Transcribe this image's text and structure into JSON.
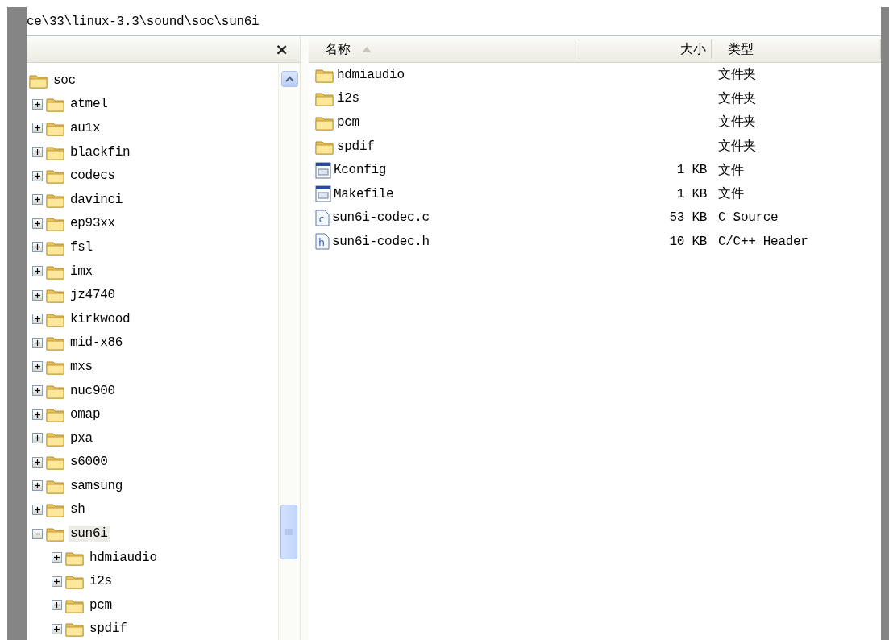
{
  "address": {
    "value": "ce\\33\\linux-3.3\\sound\\soc\\sun6i"
  },
  "folders_pane": {
    "close": "×",
    "tree": [
      {
        "name": "soc",
        "selected": false,
        "children": [
          {
            "name": "atmel",
            "expanded": false,
            "selected": false
          },
          {
            "name": "au1x",
            "expanded": false,
            "selected": false
          },
          {
            "name": "blackfin",
            "expanded": false,
            "selected": false
          },
          {
            "name": "codecs",
            "expanded": false,
            "selected": false
          },
          {
            "name": "davinci",
            "expanded": false,
            "selected": false
          },
          {
            "name": "ep93xx",
            "expanded": false,
            "selected": false
          },
          {
            "name": "fsl",
            "expanded": false,
            "selected": false
          },
          {
            "name": "imx",
            "expanded": false,
            "selected": false
          },
          {
            "name": "jz4740",
            "expanded": false,
            "selected": false
          },
          {
            "name": "kirkwood",
            "expanded": false,
            "selected": false
          },
          {
            "name": "mid-x86",
            "expanded": false,
            "selected": false
          },
          {
            "name": "mxs",
            "expanded": false,
            "selected": false
          },
          {
            "name": "nuc900",
            "expanded": false,
            "selected": false
          },
          {
            "name": "omap",
            "expanded": false,
            "selected": false
          },
          {
            "name": "pxa",
            "expanded": false,
            "selected": false
          },
          {
            "name": "s6000",
            "expanded": false,
            "selected": false
          },
          {
            "name": "samsung",
            "expanded": false,
            "selected": false
          },
          {
            "name": "sh",
            "expanded": false,
            "selected": false
          },
          {
            "name": "sun6i",
            "expanded": true,
            "selected": true,
            "children": [
              {
                "name": "hdmiaudio",
                "expanded": false,
                "selected": false
              },
              {
                "name": "i2s",
                "expanded": false,
                "selected": false
              },
              {
                "name": "pcm",
                "expanded": false,
                "selected": false
              },
              {
                "name": "spdif",
                "expanded": false,
                "selected": false
              }
            ]
          }
        ]
      }
    ]
  },
  "file_list": {
    "columns": [
      {
        "label": "名称",
        "sorted": true
      },
      {
        "label": "大小",
        "sorted": false
      },
      {
        "label": "类型",
        "sorted": false
      }
    ],
    "rows": [
      {
        "kind": "folder",
        "name": "hdmiaudio",
        "size": "",
        "type": "文件夹"
      },
      {
        "kind": "folder",
        "name": "i2s",
        "size": "",
        "type": "文件夹"
      },
      {
        "kind": "folder",
        "name": "pcm",
        "size": "",
        "type": "文件夹"
      },
      {
        "kind": "folder",
        "name": "spdif",
        "size": "",
        "type": "文件夹"
      },
      {
        "kind": "config",
        "name": "Kconfig",
        "size": "1 KB",
        "type": "文件"
      },
      {
        "kind": "config",
        "name": "Makefile",
        "size": "1 KB",
        "type": "文件"
      },
      {
        "kind": "source",
        "badge": "c",
        "name": "sun6i-codec.c",
        "size": "53 KB",
        "type": "C Source"
      },
      {
        "kind": "source",
        "badge": "h",
        "name": "sun6i-codec.h",
        "size": "10 KB",
        "type": "C/C++ Header"
      }
    ]
  }
}
